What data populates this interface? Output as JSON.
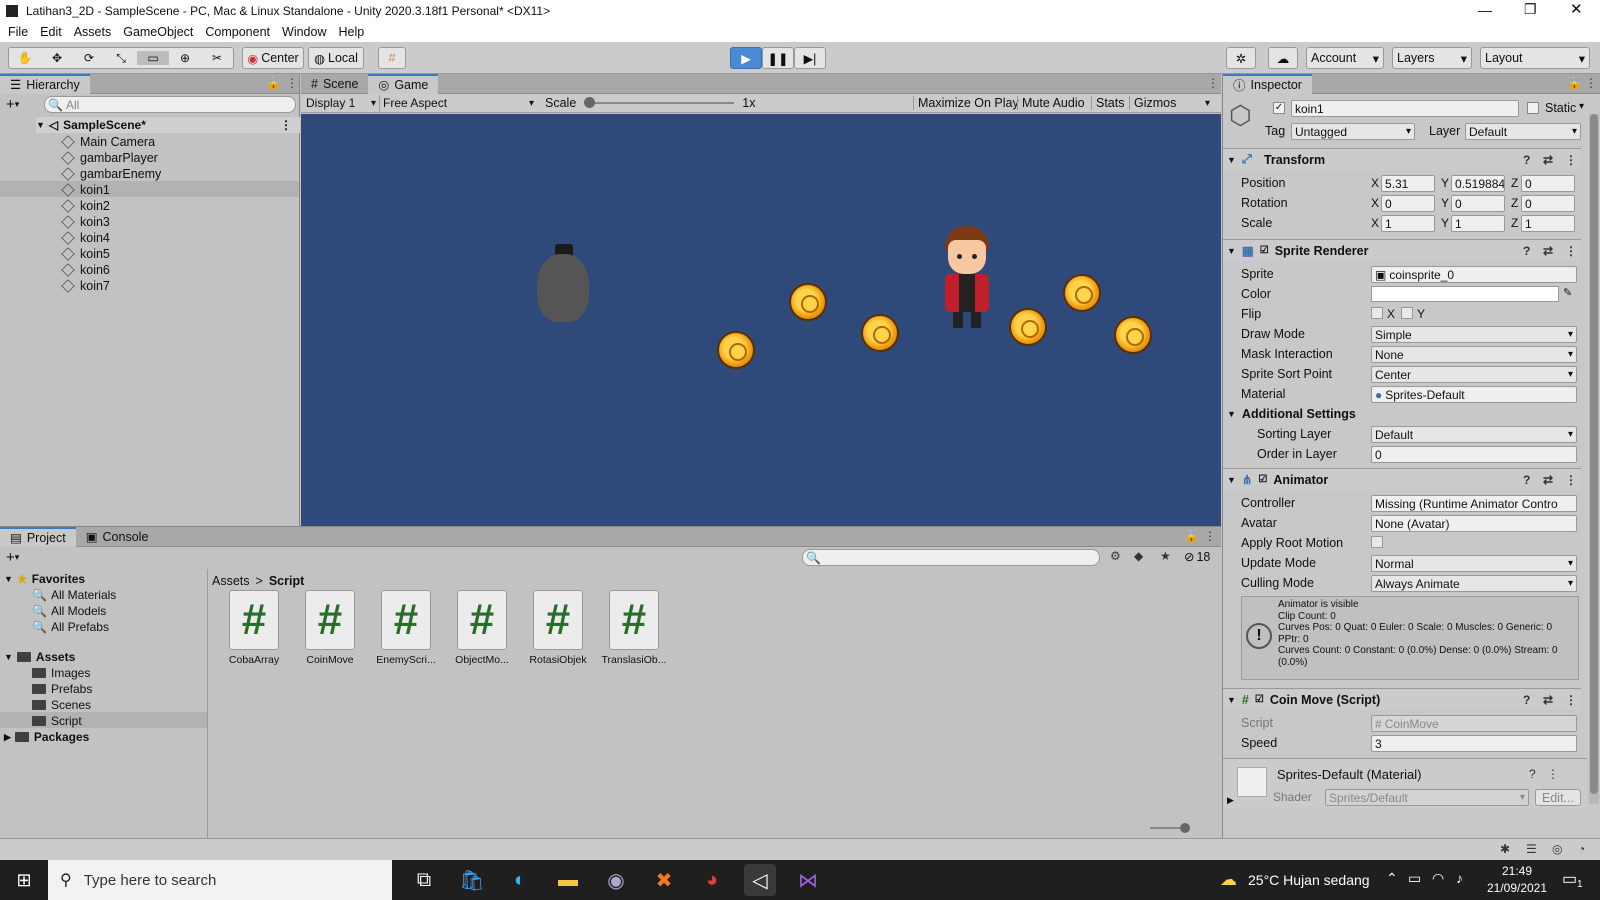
{
  "window": {
    "title": "Latihan3_2D - SampleScene - PC, Mac & Linux Standalone - Unity 2020.3.18f1 Personal* <DX11>"
  },
  "menu": [
    "File",
    "Edit",
    "Assets",
    "GameObject",
    "Component",
    "Window",
    "Help"
  ],
  "toolbar": {
    "center": "Center",
    "local": "Local",
    "account": "Account",
    "layers": "Layers",
    "layout": "Layout"
  },
  "hierarchy": {
    "tab": "Hierarchy",
    "search_placeholder": "All",
    "scene": "SampleScene*",
    "items": [
      "Main Camera",
      "gambarPlayer",
      "gambarEnemy",
      "koin1",
      "koin2",
      "koin3",
      "koin4",
      "koin5",
      "koin6",
      "koin7"
    ],
    "selected": "koin1"
  },
  "game": {
    "tab_scene": "Scene",
    "tab_game": "Game",
    "display": "Display 1",
    "aspect": "Free Aspect",
    "scale_label": "Scale",
    "scale_value": "1x",
    "maximize": "Maximize On Play",
    "mute": "Mute Audio",
    "stats": "Stats",
    "gizmos": "Gizmos",
    "bg": "#2f4a7a"
  },
  "project": {
    "tab_project": "Project",
    "tab_console": "Console",
    "count": "18",
    "favorites_label": "Favorites",
    "favorites": [
      "All Materials",
      "All Models",
      "All Prefabs"
    ],
    "assets_label": "Assets",
    "assets": [
      "Images",
      "Prefabs",
      "Scenes",
      "Script"
    ],
    "packages": "Packages",
    "breadcrumb_root": "Assets",
    "breadcrumb_current": "Script",
    "scripts": [
      "CobaArray",
      "CoinMove",
      "EnemyScri...",
      "ObjectMo...",
      "RotasiObjek",
      "TranslasiOb..."
    ]
  },
  "inspector": {
    "tab": "Inspector",
    "name": "koin1",
    "static": "Static",
    "tag_label": "Tag",
    "tag": "Untagged",
    "layer_label": "Layer",
    "layer": "Default",
    "transform": {
      "title": "Transform",
      "position_label": "Position",
      "rotation_label": "Rotation",
      "scale_label": "Scale",
      "position": [
        "5.31",
        "0.519884",
        "0"
      ],
      "rotation": [
        "0",
        "0",
        "0"
      ],
      "scale": [
        "1",
        "1",
        "1"
      ]
    },
    "sprite_renderer": {
      "title": "Sprite Renderer",
      "sprite_label": "Sprite",
      "sprite": "coinsprite_0",
      "color_label": "Color",
      "flip_label": "Flip",
      "flip_x": "X",
      "flip_y": "Y",
      "draw_mode_label": "Draw Mode",
      "draw_mode": "Simple",
      "mask_label": "Mask Interaction",
      "mask": "None",
      "sort_point_label": "Sprite Sort Point",
      "sort_point": "Center",
      "material_label": "Material",
      "material": "Sprites-Default",
      "additional": "Additional Settings",
      "sorting_layer_label": "Sorting Layer",
      "sorting_layer": "Default",
      "order_label": "Order in Layer",
      "order": "0"
    },
    "animator": {
      "title": "Animator",
      "controller_label": "Controller",
      "controller": "Missing (Runtime Animator Contro",
      "avatar_label": "Avatar",
      "avatar": "None (Avatar)",
      "root_motion_label": "Apply Root Motion",
      "update_mode_label": "Update Mode",
      "update_mode": "Normal",
      "culling_label": "Culling Mode",
      "culling": "Always Animate",
      "info": [
        "Animator is visible",
        "Clip Count: 0",
        "Curves Pos: 0 Quat: 0 Euler: 0 Scale: 0 Muscles: 0 Generic: 0",
        "PPtr: 0",
        "Curves Count: 0 Constant: 0 (0.0%) Dense: 0 (0.0%) Stream: 0",
        "(0.0%)"
      ]
    },
    "coin_move": {
      "title": "Coin Move (Script)",
      "script_label": "Script",
      "script": "CoinMove",
      "speed_label": "Speed",
      "speed": "3"
    },
    "material": {
      "title": "Sprites-Default (Material)",
      "shader_label": "Shader",
      "shader": "Sprites/Default",
      "edit": "Edit..."
    }
  },
  "taskbar": {
    "search_placeholder": "Type here to search",
    "weather": "25°C  Hujan sedang",
    "time": "21:49",
    "date": "21/09/2021",
    "notif": "1"
  }
}
